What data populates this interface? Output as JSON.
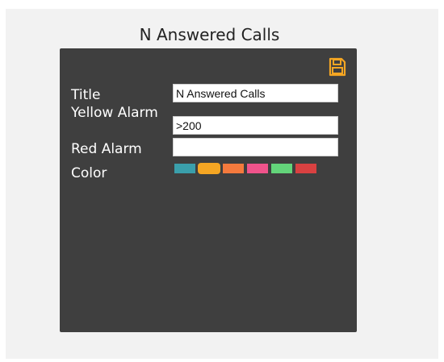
{
  "page": {
    "title": "N Answered Calls"
  },
  "form": {
    "title_label": "Title",
    "title_value": "N Answered Calls",
    "yellow_label": "Yellow Alarm",
    "yellow_value": ">200",
    "red_label": "Red Alarm",
    "red_value": "",
    "color_label": "Color"
  },
  "save": {
    "icon": "save-icon",
    "color": "#f5a623"
  },
  "colors": [
    {
      "name": "teal",
      "hex": "#3a9fab",
      "selected": false
    },
    {
      "name": "orange",
      "hex": "#f5a623",
      "selected": true
    },
    {
      "name": "coral",
      "hex": "#f57a3d",
      "selected": false
    },
    {
      "name": "pink",
      "hex": "#f0538b",
      "selected": false
    },
    {
      "name": "green",
      "hex": "#63d47a",
      "selected": false
    },
    {
      "name": "red",
      "hex": "#d94141",
      "selected": false
    }
  ]
}
